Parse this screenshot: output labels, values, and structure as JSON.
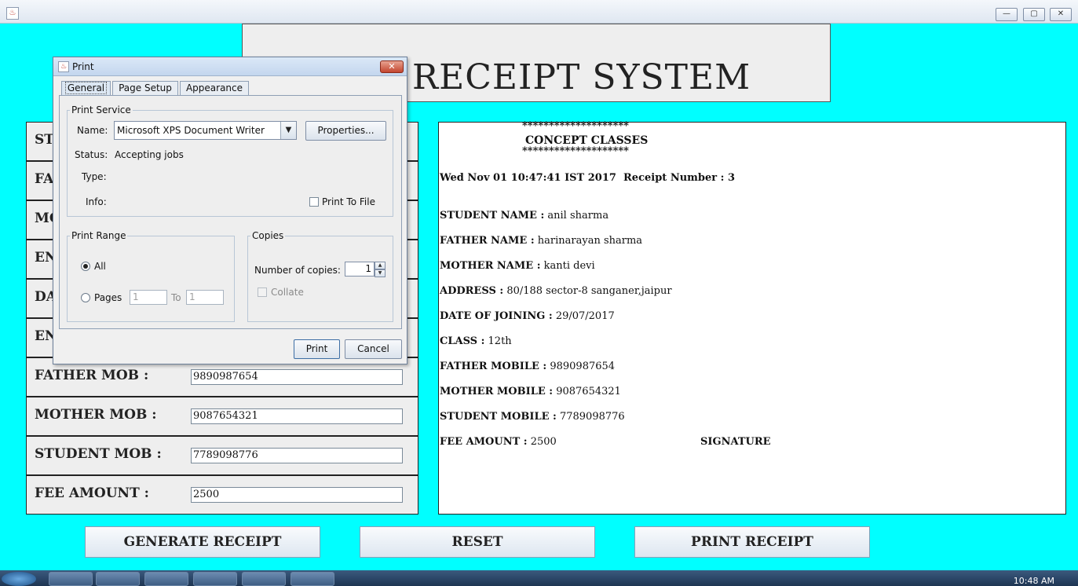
{
  "window": {
    "controls": {
      "minimize": "—",
      "maximize": "▢",
      "close": "✕"
    }
  },
  "header": {
    "title": "RECEIPT SYSTEM"
  },
  "form": {
    "rows": [
      {
        "label": "ST",
        "value": ""
      },
      {
        "label": "FA",
        "value": ""
      },
      {
        "label": "MO",
        "value": ""
      },
      {
        "label": "EN",
        "value": ""
      },
      {
        "label": "DA",
        "value": ""
      },
      {
        "label": "EN",
        "value": ""
      },
      {
        "label": "FATHER MOB :",
        "value": "9890987654"
      },
      {
        "label": "MOTHER MOB :",
        "value": "9087654321"
      },
      {
        "label": "STUDENT MOB :",
        "value": "7789098776"
      },
      {
        "label": "FEE AMOUNT :",
        "value": "2500"
      }
    ]
  },
  "receipt": {
    "stars": "********************",
    "institute": "CONCEPT CLASSES",
    "datetime": "Wed Nov 01 10:47:41 IST 2017",
    "receipt_number": "Receipt Number : 3",
    "lines": [
      {
        "label": "STUDENT NAME :",
        "value": "anil sharma"
      },
      {
        "label": "FATHER NAME :",
        "value": "harinarayan sharma"
      },
      {
        "label": "MOTHER NAME :",
        "value": "kanti devi"
      },
      {
        "label": "ADDRESS :",
        "value": "80/188 sector-8 sanganer,jaipur"
      },
      {
        "label": "DATE OF JOINING :",
        "value": "29/07/2017"
      },
      {
        "label": "CLASS :",
        "value": "12th"
      },
      {
        "label": "FATHER MOBILE :",
        "value": "9890987654"
      },
      {
        "label": "MOTHER MOBILE :",
        "value": "9087654321"
      },
      {
        "label": "STUDENT MOBILE :",
        "value": "7789098776"
      },
      {
        "label": "FEE AMOUNT :",
        "value": "2500"
      }
    ],
    "signature": "SIGNATURE"
  },
  "buttons": {
    "generate": "GENERATE RECEIPT",
    "reset": "RESET",
    "print": "PRINT RECEIPT"
  },
  "print_dialog": {
    "title": "Print",
    "close_glyph": "✕",
    "tabs": [
      "General",
      "Page Setup",
      "Appearance"
    ],
    "active_tab": "General",
    "print_service": {
      "group_label": "Print Service",
      "name_label": "Name:",
      "printer": "Microsoft XPS Document Writer",
      "properties_button": "Properties...",
      "status_label": "Status:",
      "status_value": "Accepting jobs",
      "type_label": "Type:",
      "info_label": "Info:",
      "print_to_file": "Print To File"
    },
    "print_range": {
      "group_label": "Print Range",
      "all": "All",
      "pages": "Pages",
      "from": "1",
      "to_label": "To",
      "to": "1",
      "selected": "All"
    },
    "copies": {
      "group_label": "Copies",
      "number_label": "Number of copies:",
      "value": "1",
      "collate": "Collate"
    },
    "print_button": "Print",
    "cancel_button": "Cancel"
  },
  "taskbar": {
    "clock": "10:48 AM"
  }
}
